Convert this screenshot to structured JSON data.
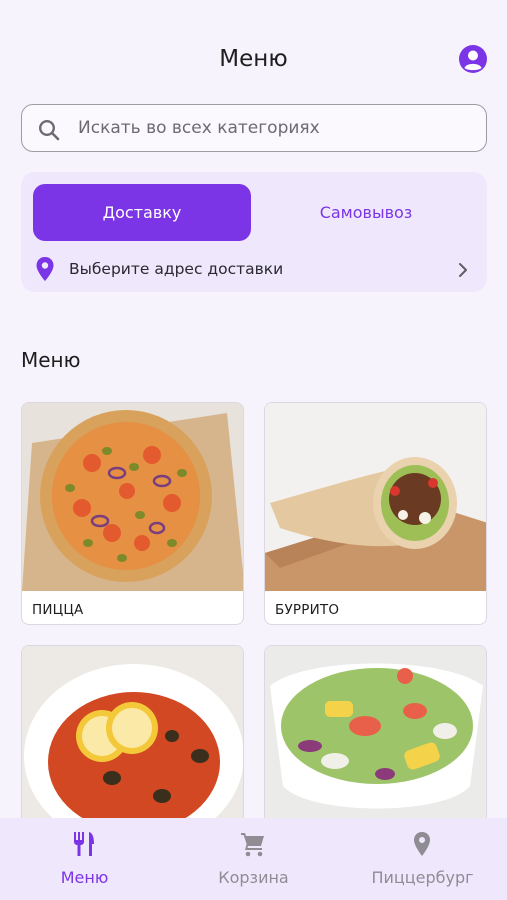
{
  "header": {
    "title": "Меню"
  },
  "search": {
    "placeholder": "Искать во всех категориях"
  },
  "delivery": {
    "tabs": [
      {
        "label": "Доставку",
        "active": true
      },
      {
        "label": "Самовывоз",
        "active": false
      }
    ],
    "address_label": "Выберите адрес доставки"
  },
  "menu": {
    "section_title": "Меню",
    "categories": [
      {
        "label": "ПИЦЦА",
        "image": "pizza-image"
      },
      {
        "label": "БУРРИТО",
        "image": "burrito-image"
      },
      {
        "label": "",
        "image": "soup-image"
      },
      {
        "label": "",
        "image": "salad-image"
      }
    ]
  },
  "bottom_nav": {
    "items": [
      {
        "label": "Меню",
        "icon": "fork-knife-icon",
        "active": true
      },
      {
        "label": "Корзина",
        "icon": "cart-icon",
        "active": false
      },
      {
        "label": "Пиццербург",
        "icon": "location-pin-icon",
        "active": false
      }
    ]
  },
  "colors": {
    "accent": "#7B35E6",
    "background": "#F7F3FD",
    "card_background": "#EFE8FC",
    "inactive": "#8F8C94"
  }
}
